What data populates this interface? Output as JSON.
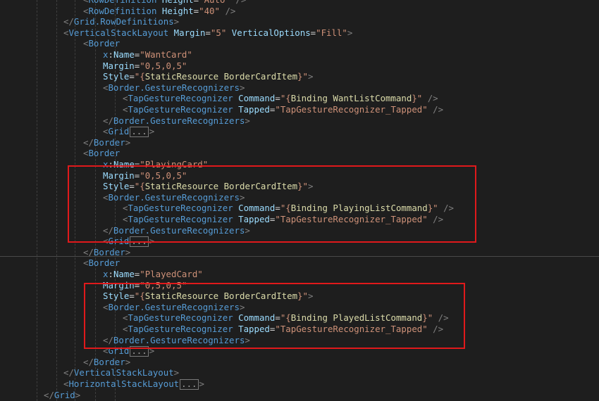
{
  "colors": {
    "background": "#1e1e1e",
    "tag": "#569cd6",
    "attribute": "#9cdcfe",
    "string": "#ce9178",
    "binding": "#dcdcaa",
    "highlight_border": "#e0191b"
  },
  "lines": [
    {
      "indent": 5,
      "tokens": [
        [
          "b",
          "<"
        ],
        [
          "g",
          "RowDefinition"
        ],
        [
          "a",
          " Height"
        ],
        [
          "e",
          "="
        ],
        [
          "s",
          "\"Auto\""
        ],
        [
          "b",
          " />"
        ]
      ]
    },
    {
      "indent": 5,
      "tokens": [
        [
          "b",
          "<"
        ],
        [
          "g",
          "RowDefinition"
        ],
        [
          "a",
          " Height"
        ],
        [
          "e",
          "="
        ],
        [
          "s",
          "\"40\""
        ],
        [
          "b",
          " />"
        ]
      ]
    },
    {
      "indent": 4,
      "tokens": [
        [
          "b",
          "</"
        ],
        [
          "g",
          "Grid.RowDefinitions"
        ],
        [
          "b",
          ">"
        ]
      ]
    },
    {
      "indent": 4,
      "tokens": [
        [
          "b",
          "<"
        ],
        [
          "g",
          "VerticalStackLayout"
        ],
        [
          "a",
          " Margin"
        ],
        [
          "e",
          "="
        ],
        [
          "s",
          "\"5\""
        ],
        [
          "a",
          " VerticalOptions"
        ],
        [
          "e",
          "="
        ],
        [
          "s",
          "\"Fill\""
        ],
        [
          "b",
          ">"
        ]
      ]
    },
    {
      "indent": 5,
      "tokens": [
        [
          "b",
          "<"
        ],
        [
          "g",
          "Border"
        ]
      ]
    },
    {
      "indent": 6,
      "tokens": [
        [
          "x",
          "x"
        ],
        [
          "e",
          ":"
        ],
        [
          "a",
          "Name"
        ],
        [
          "e",
          "="
        ],
        [
          "s",
          "\"WantCard\""
        ]
      ]
    },
    {
      "indent": 6,
      "tokens": [
        [
          "a",
          "Margin"
        ],
        [
          "e",
          "="
        ],
        [
          "s",
          "\"0,5,0,5\""
        ]
      ]
    },
    {
      "indent": 6,
      "tokens": [
        [
          "a",
          "Style"
        ],
        [
          "e",
          "="
        ],
        [
          "s",
          "\"{"
        ],
        [
          "k",
          "StaticResource"
        ],
        [
          "n",
          " BorderCardItem"
        ],
        [
          "s",
          "}\""
        ],
        [
          "b",
          ">"
        ]
      ]
    },
    {
      "indent": 6,
      "tokens": [
        [
          "b",
          "<"
        ],
        [
          "g",
          "Border.GestureRecognizers"
        ],
        [
          "b",
          ">"
        ]
      ]
    },
    {
      "indent": 7,
      "tokens": [
        [
          "b",
          "<"
        ],
        [
          "g",
          "TapGestureRecognizer"
        ],
        [
          "a",
          " Command"
        ],
        [
          "e",
          "="
        ],
        [
          "s",
          "\"{"
        ],
        [
          "k",
          "Binding"
        ],
        [
          "n",
          " WantListCommand"
        ],
        [
          "s",
          "}\""
        ],
        [
          "b",
          " />"
        ]
      ]
    },
    {
      "indent": 7,
      "tokens": [
        [
          "b",
          "<"
        ],
        [
          "g",
          "TapGestureRecognizer"
        ],
        [
          "a",
          " Tapped"
        ],
        [
          "e",
          "="
        ],
        [
          "s",
          "\"TapGestureRecognizer_Tapped\""
        ],
        [
          "b",
          " />"
        ]
      ]
    },
    {
      "indent": 6,
      "tokens": [
        [
          "b",
          "</"
        ],
        [
          "g",
          "Border.GestureRecognizers"
        ],
        [
          "b",
          ">"
        ]
      ]
    },
    {
      "indent": 6,
      "tokens": [
        [
          "b",
          "<"
        ],
        [
          "g",
          "Grid"
        ],
        [
          "c",
          "..."
        ],
        [
          "b",
          ">"
        ]
      ]
    },
    {
      "indent": 5,
      "tokens": [
        [
          "b",
          "</"
        ],
        [
          "g",
          "Border"
        ],
        [
          "b",
          ">"
        ]
      ]
    },
    {
      "indent": 5,
      "tokens": [
        [
          "b",
          "<"
        ],
        [
          "g",
          "Border"
        ]
      ]
    },
    {
      "indent": 6,
      "tokens": [
        [
          "x",
          "x"
        ],
        [
          "e",
          ":"
        ],
        [
          "a",
          "Name"
        ],
        [
          "e",
          "="
        ],
        [
          "s",
          "\"PlayingCard\""
        ]
      ]
    },
    {
      "indent": 6,
      "tokens": [
        [
          "a",
          "Margin"
        ],
        [
          "e",
          "="
        ],
        [
          "s",
          "\"0,5,0,5\""
        ]
      ]
    },
    {
      "indent": 6,
      "tokens": [
        [
          "a",
          "Style"
        ],
        [
          "e",
          "="
        ],
        [
          "s",
          "\"{"
        ],
        [
          "k",
          "StaticResource"
        ],
        [
          "n",
          " BorderCardItem"
        ],
        [
          "s",
          "}\""
        ],
        [
          "b",
          ">"
        ]
      ]
    },
    {
      "indent": 6,
      "tokens": [
        [
          "b",
          "<"
        ],
        [
          "g",
          "Border.GestureRecognizers"
        ],
        [
          "b",
          ">"
        ]
      ]
    },
    {
      "indent": 7,
      "tokens": [
        [
          "b",
          "<"
        ],
        [
          "g",
          "TapGestureRecognizer"
        ],
        [
          "a",
          " Command"
        ],
        [
          "e",
          "="
        ],
        [
          "s",
          "\"{"
        ],
        [
          "k",
          "Binding"
        ],
        [
          "n",
          " PlayingListCommand"
        ],
        [
          "s",
          "}\""
        ],
        [
          "b",
          " />"
        ]
      ]
    },
    {
      "indent": 7,
      "tokens": [
        [
          "b",
          "<"
        ],
        [
          "g",
          "TapGestureRecognizer"
        ],
        [
          "a",
          " Tapped"
        ],
        [
          "e",
          "="
        ],
        [
          "s",
          "\"TapGestureRecognizer_Tapped\""
        ],
        [
          "b",
          " />"
        ]
      ]
    },
    {
      "indent": 6,
      "tokens": [
        [
          "b",
          "</"
        ],
        [
          "g",
          "Border.GestureRecognizers"
        ],
        [
          "b",
          ">"
        ]
      ]
    },
    {
      "indent": 6,
      "tokens": [
        [
          "b",
          "<"
        ],
        [
          "g",
          "Grid"
        ],
        [
          "c",
          "..."
        ],
        [
          "b",
          ">"
        ]
      ]
    },
    {
      "indent": 5,
      "tokens": [
        [
          "b",
          "</"
        ],
        [
          "g",
          "Border"
        ],
        [
          "b",
          ">"
        ]
      ]
    },
    {
      "indent": 5,
      "tokens": [
        [
          "b",
          "<"
        ],
        [
          "g",
          "Border"
        ]
      ]
    },
    {
      "indent": 6,
      "tokens": [
        [
          "x",
          "x"
        ],
        [
          "e",
          ":"
        ],
        [
          "a",
          "Name"
        ],
        [
          "e",
          "="
        ],
        [
          "s",
          "\"PlayedCard\""
        ]
      ]
    },
    {
      "indent": 6,
      "tokens": [
        [
          "a",
          "Margin"
        ],
        [
          "e",
          "="
        ],
        [
          "s",
          "\"0,5,0,5\""
        ]
      ]
    },
    {
      "indent": 6,
      "tokens": [
        [
          "a",
          "Style"
        ],
        [
          "e",
          "="
        ],
        [
          "s",
          "\"{"
        ],
        [
          "k",
          "StaticResource"
        ],
        [
          "n",
          " BorderCardItem"
        ],
        [
          "s",
          "}\""
        ],
        [
          "b",
          ">"
        ]
      ]
    },
    {
      "indent": 6,
      "tokens": [
        [
          "b",
          "<"
        ],
        [
          "g",
          "Border.GestureRecognizers"
        ],
        [
          "b",
          ">"
        ]
      ]
    },
    {
      "indent": 7,
      "tokens": [
        [
          "b",
          "<"
        ],
        [
          "g",
          "TapGestureRecognizer"
        ],
        [
          "a",
          " Command"
        ],
        [
          "e",
          "="
        ],
        [
          "s",
          "\"{"
        ],
        [
          "k",
          "Binding"
        ],
        [
          "n",
          " PlayedListCommand"
        ],
        [
          "s",
          "}\""
        ],
        [
          "b",
          " />"
        ]
      ]
    },
    {
      "indent": 7,
      "tokens": [
        [
          "b",
          "<"
        ],
        [
          "g",
          "TapGestureRecognizer"
        ],
        [
          "a",
          " Tapped"
        ],
        [
          "e",
          "="
        ],
        [
          "s",
          "\"TapGestureRecognizer_Tapped\""
        ],
        [
          "b",
          " />"
        ]
      ]
    },
    {
      "indent": 6,
      "tokens": [
        [
          "b",
          "</"
        ],
        [
          "g",
          "Border.GestureRecognizers"
        ],
        [
          "b",
          ">"
        ]
      ]
    },
    {
      "indent": 6,
      "tokens": [
        [
          "b",
          "<"
        ],
        [
          "g",
          "Grid"
        ],
        [
          "c",
          "..."
        ],
        [
          "b",
          ">"
        ]
      ]
    },
    {
      "indent": 5,
      "tokens": [
        [
          "b",
          "</"
        ],
        [
          "g",
          "Border"
        ],
        [
          "b",
          ">"
        ]
      ]
    },
    {
      "indent": 4,
      "tokens": [
        [
          "b",
          "</"
        ],
        [
          "g",
          "VerticalStackLayout"
        ],
        [
          "b",
          ">"
        ]
      ]
    },
    {
      "indent": 4,
      "tokens": [
        [
          "b",
          "<"
        ],
        [
          "g",
          "HorizontalStackLayout"
        ],
        [
          "c",
          "..."
        ],
        [
          "b",
          ">"
        ]
      ]
    },
    {
      "indent": 3,
      "tokens": [
        [
          "b",
          "</"
        ],
        [
          "g",
          "Grid"
        ],
        [
          "b",
          ">"
        ]
      ]
    }
  ]
}
